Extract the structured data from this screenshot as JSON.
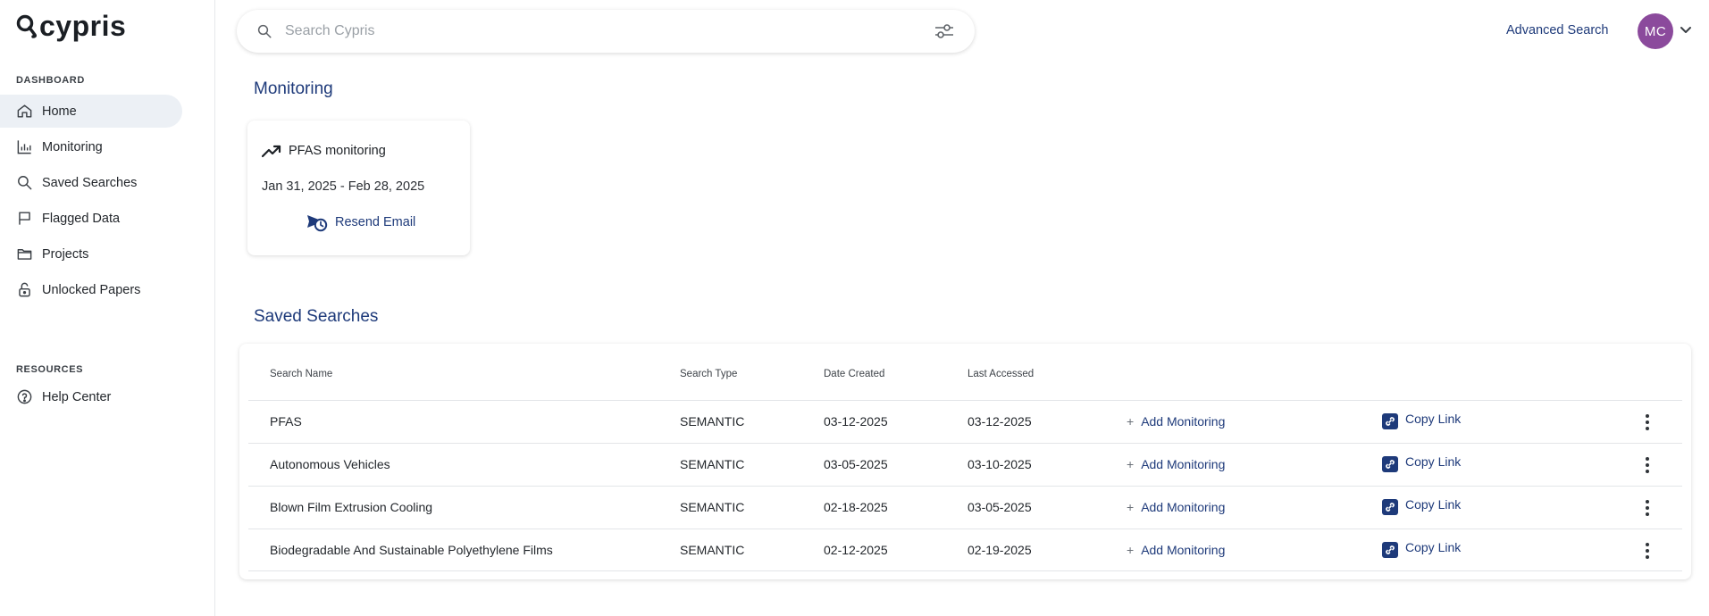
{
  "app": {
    "name": "cypris"
  },
  "sidebar": {
    "dashboard_label": "DASHBOARD",
    "items": [
      {
        "label": "Home",
        "icon": "home-icon"
      },
      {
        "label": "Monitoring",
        "icon": "bar-chart-icon"
      },
      {
        "label": "Saved Searches",
        "icon": "search-icon"
      },
      {
        "label": "Flagged Data",
        "icon": "flag-icon"
      },
      {
        "label": "Projects",
        "icon": "folder-icon"
      },
      {
        "label": "Unlocked Papers",
        "icon": "unlock-icon"
      }
    ],
    "resources_label": "RESOURCES",
    "resources": [
      {
        "label": "Help Center",
        "icon": "help-icon"
      }
    ]
  },
  "header": {
    "search_placeholder": "Search Cypris",
    "advanced_search": "Advanced Search",
    "avatar_initials": "MC",
    "avatar_color": "#8b4a9c"
  },
  "monitoring": {
    "heading": "Monitoring",
    "card": {
      "title": "PFAS monitoring",
      "date_range": "Jan 31, 2025 - Feb 28, 2025",
      "resend_label": "Resend Email"
    }
  },
  "saved_searches": {
    "heading": "Saved Searches",
    "columns": [
      "Search Name",
      "Search Type",
      "Date Created",
      "Last Accessed"
    ],
    "add_monitoring_label": "Add Monitoring",
    "copy_link_label": "Copy Link",
    "rows": [
      {
        "name": "PFAS",
        "type": "SEMANTIC",
        "created": "03-12-2025",
        "accessed": "03-12-2025"
      },
      {
        "name": "Autonomous Vehicles",
        "type": "SEMANTIC",
        "created": "03-05-2025",
        "accessed": "03-10-2025"
      },
      {
        "name": "Blown Film Extrusion Cooling",
        "type": "SEMANTIC",
        "created": "02-18-2025",
        "accessed": "03-05-2025"
      },
      {
        "name": "Biodegradable And Sustainable Polyethylene Films",
        "type": "SEMANTIC",
        "created": "02-12-2025",
        "accessed": "02-19-2025"
      }
    ]
  },
  "colors": {
    "accent": "#1e3a7a",
    "active_nav_bg": "#ecf0f5"
  }
}
